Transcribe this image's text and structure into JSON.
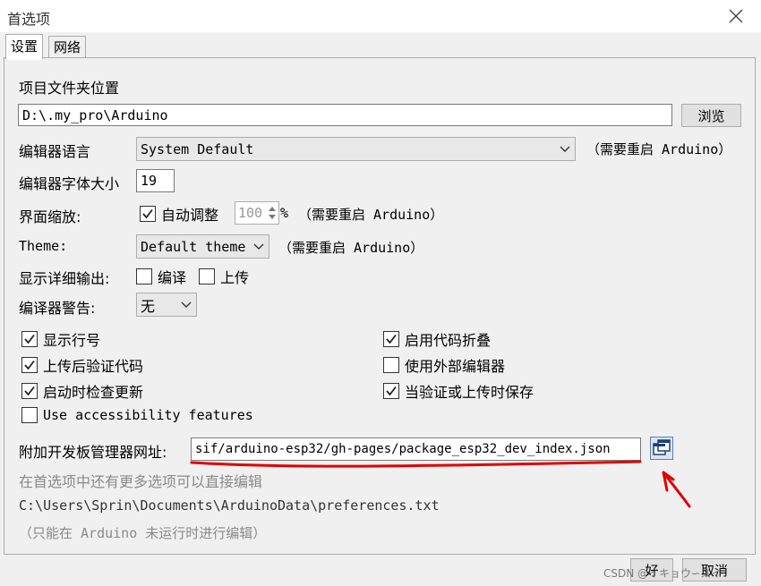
{
  "window": {
    "title": "首选项",
    "close_icon": "close-icon"
  },
  "tabs": [
    {
      "label": "设置",
      "active": true
    },
    {
      "label": "网络",
      "active": false
    }
  ],
  "settings": {
    "sketchbook_label": "项目文件夹位置",
    "sketchbook_path": "D:\\.my_pro\\Arduino",
    "browse_button": "浏览",
    "editor_language_label": "编辑器语言",
    "editor_language_value": "System Default",
    "restart_note": "（需要重启 Arduino）",
    "font_size_label": "编辑器字体大小",
    "font_size_value": "19",
    "scale_label": "界面缩放:",
    "auto_adjust_label": "自动调整",
    "auto_adjust_checked": true,
    "scale_value": "100",
    "percent": "%",
    "theme_label": "Theme:",
    "theme_value": "Default theme",
    "verbose_label": "显示详细输出:",
    "verbose_compile": "编译",
    "verbose_upload": "上传",
    "warnings_label": "编译器警告:",
    "warnings_value": "无",
    "options_left": [
      {
        "label": "显示行号",
        "checked": true
      },
      {
        "label": "上传后验证代码",
        "checked": true
      },
      {
        "label": "启动时检查更新",
        "checked": true
      },
      {
        "label": "Use accessibility features",
        "checked": false
      }
    ],
    "options_right": [
      {
        "label": "启用代码折叠",
        "checked": true
      },
      {
        "label": "使用外部编辑器",
        "checked": false
      },
      {
        "label": "当验证或上传时保存",
        "checked": true
      }
    ],
    "boards_url_label": "附加开发板管理器网址:",
    "boards_url_value": "sif/arduino-esp32/gh-pages/package_esp32_dev_index.json",
    "more_prefs_note": "在首选项中还有更多选项可以直接编辑",
    "prefs_path": "C:\\Users\\Sprin\\Documents\\ArduinoData\\preferences.txt",
    "edit_note": "（只能在 Arduino 未运行时进行编辑）"
  },
  "footer": {
    "ok_button": "好",
    "cancel_button": "取消",
    "watermark": "CSDN @イキョウ∽スイ"
  },
  "annotation_color": "#e00000"
}
